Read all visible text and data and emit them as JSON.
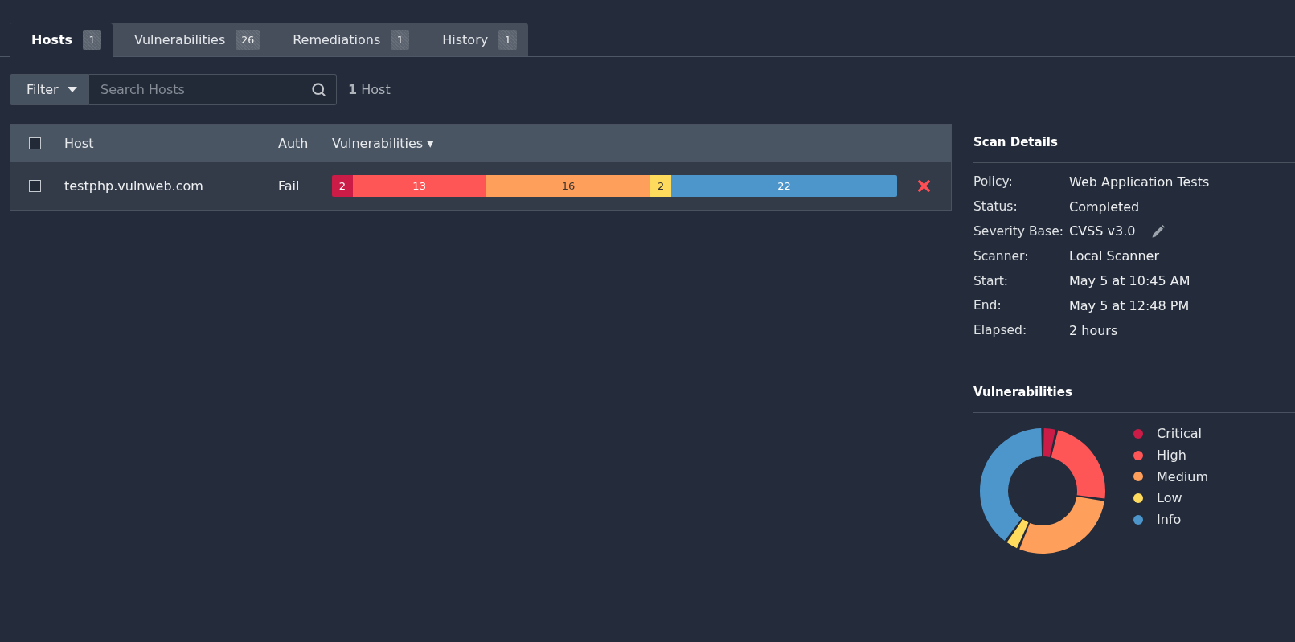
{
  "tabs": [
    {
      "label": "Hosts",
      "count": "1",
      "selected": true
    },
    {
      "label": "Vulnerabilities",
      "count": "26",
      "selected": false
    },
    {
      "label": "Remediations",
      "count": "1",
      "selected": false
    },
    {
      "label": "History",
      "count": "1",
      "selected": false
    }
  ],
  "filter": {
    "label": "Filter"
  },
  "search": {
    "placeholder": "Search Hosts"
  },
  "result_count": "**1** Host",
  "table": {
    "select_all": {
      "checked": false
    },
    "columns": [
      {
        "label": "Host"
      },
      {
        "label": "Auth"
      },
      {
        "label": "Vulnerabilities ▾"
      }
    ],
    "rows": [
      {
        "checked": false,
        "host": "testphp.vulnweb.com",
        "auth": "Fail",
        "removable": true,
        "severities": [
          {
            "count": "2",
            "color": "#cb1c47"
          },
          {
            "count": "13",
            "color": "#fe5656"
          },
          {
            "count": "16",
            "color": "#fe9f5b"
          },
          {
            "count": "2",
            "color": "#fedb5d"
          },
          {
            "count": "22",
            "color": "#4d96cc"
          }
        ]
      }
    ]
  },
  "scan_details": {
    "title": "Scan Details",
    "rows": [
      {
        "label": "Policy:",
        "value": "Web Application Tests",
        "editable": false
      },
      {
        "label": "Status:",
        "value": "Completed",
        "editable": false
      },
      {
        "label": "Severity Base:",
        "value": "CVSS v3.0",
        "editable": true
      },
      {
        "label": "Scanner:",
        "value": "Local Scanner",
        "editable": false
      },
      {
        "label": "Start:",
        "value": "May 5 at 10:45 AM",
        "editable": false
      },
      {
        "label": "End:",
        "value": "May 5 at 12:48 PM",
        "editable": false
      },
      {
        "label": "Elapsed:",
        "value": "2 hours",
        "editable": false
      }
    ]
  },
  "vulnerabilities": {
    "title": "Vulnerabilities",
    "legend": [
      {
        "label": "Critical",
        "color": "#cb1c47"
      },
      {
        "label": "High",
        "color": "#fe5656"
      },
      {
        "label": "Medium",
        "color": "#fe9f5b"
      },
      {
        "label": "Low",
        "color": "#fedb5d"
      },
      {
        "label": "Info",
        "color": "#4d96cc"
      }
    ]
  }
}
